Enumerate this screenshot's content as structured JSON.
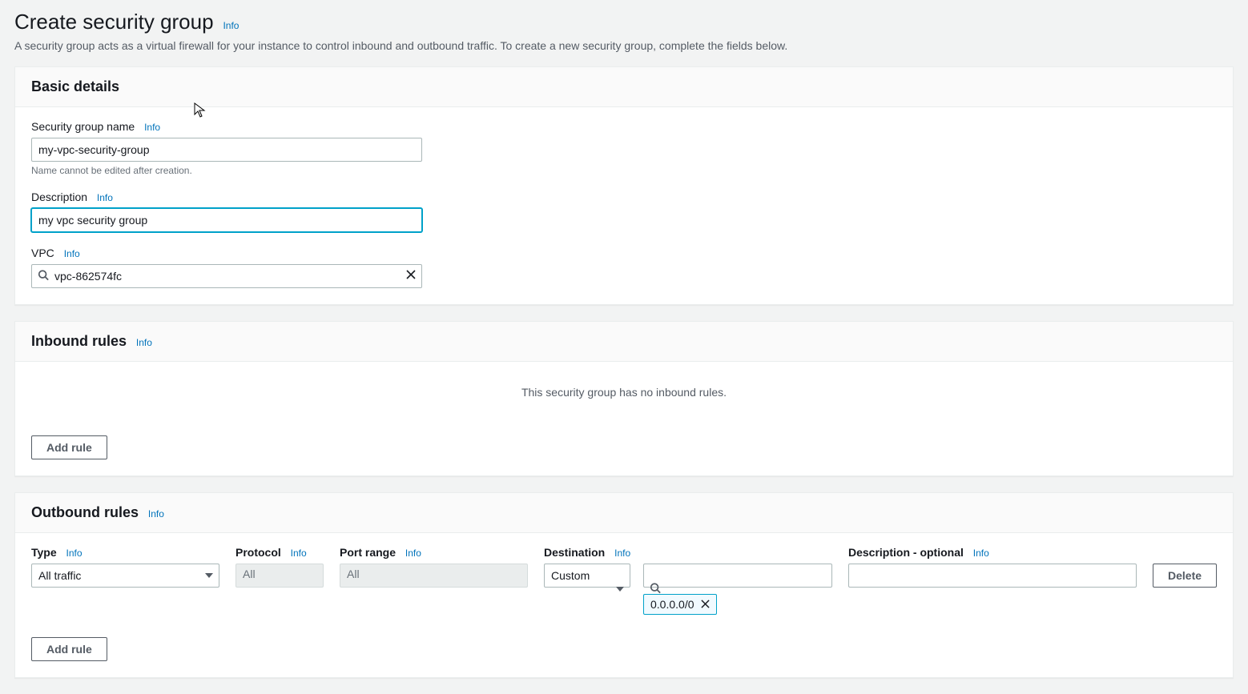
{
  "header": {
    "title": "Create security group",
    "info": "Info",
    "description": "A security group acts as a virtual firewall for your instance to control inbound and outbound traffic. To create a new security group, complete the fields below."
  },
  "basic": {
    "panel_title": "Basic details",
    "name_label": "Security group name",
    "name_info": "Info",
    "name_value": "my-vpc-security-group",
    "name_helper": "Name cannot be edited after creation.",
    "desc_label": "Description",
    "desc_info": "Info",
    "desc_value": "my vpc security group",
    "vpc_label": "VPC",
    "vpc_info": "Info",
    "vpc_value": "vpc-862574fc"
  },
  "inbound": {
    "panel_title": "Inbound rules",
    "info": "Info",
    "empty_text": "This security group has no inbound rules.",
    "add_rule_label": "Add rule"
  },
  "outbound": {
    "panel_title": "Outbound rules",
    "info": "Info",
    "columns": {
      "type": "Type",
      "type_info": "Info",
      "protocol": "Protocol",
      "protocol_info": "Info",
      "portrange": "Port range",
      "portrange_info": "Info",
      "destination": "Destination",
      "destination_info": "Info",
      "description": "Description - optional",
      "description_info": "Info"
    },
    "row": {
      "type": "All traffic",
      "protocol": "All",
      "portrange": "All",
      "dest_mode": "Custom",
      "dest_token": "0.0.0.0/0"
    },
    "delete_label": "Delete",
    "add_rule_label": "Add rule"
  }
}
